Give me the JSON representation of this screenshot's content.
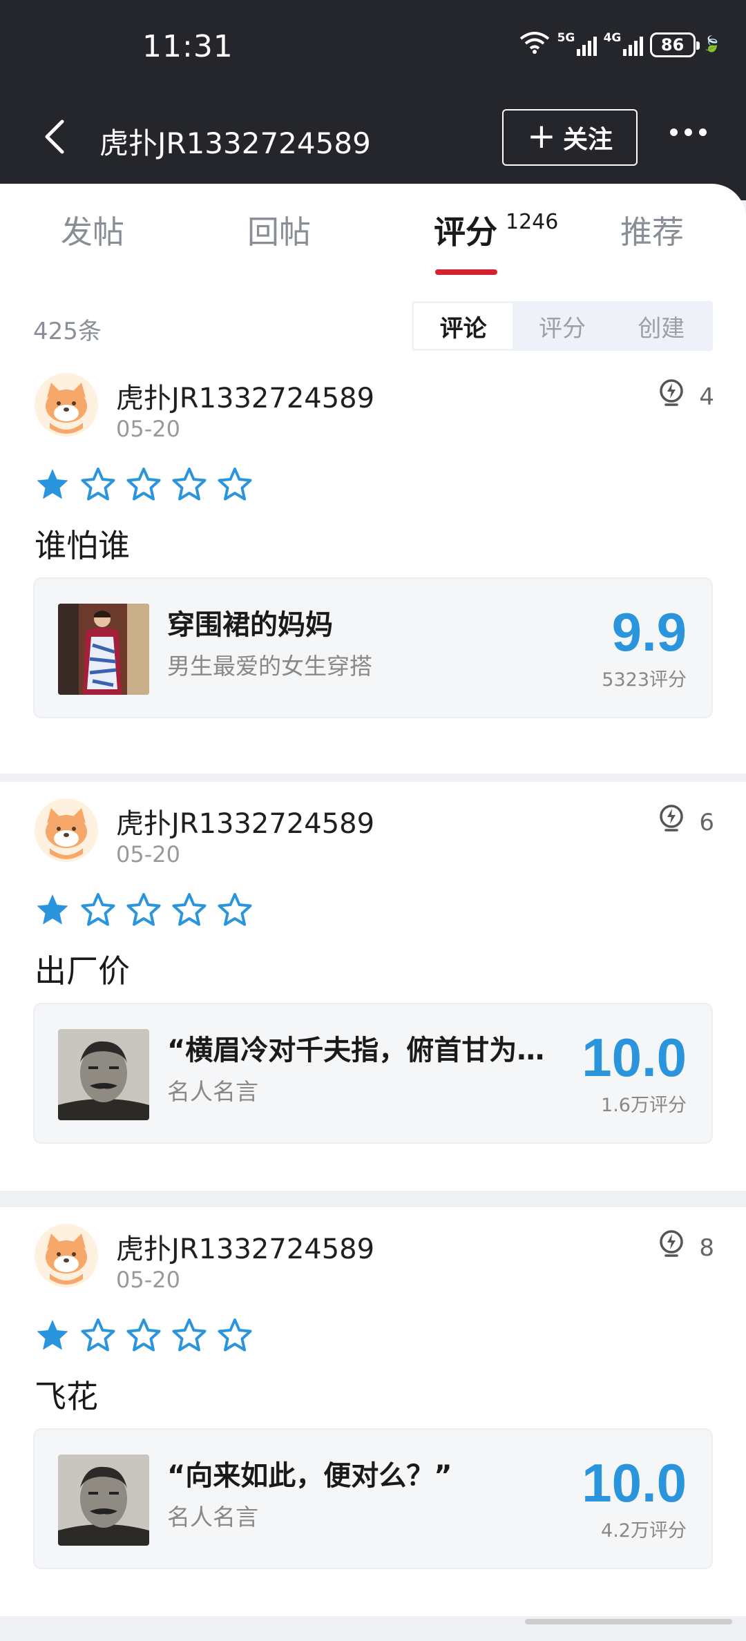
{
  "status_bar": {
    "time": "11:31",
    "sig1": "5G",
    "sig2": "4G",
    "battery": "86"
  },
  "nav": {
    "title": "虎扑JR1332724589",
    "follow_label": "关注"
  },
  "tabs": [
    {
      "label": "发帖"
    },
    {
      "label": "回帖"
    },
    {
      "label": "评分",
      "count": "1246"
    },
    {
      "label": "推荐"
    }
  ],
  "list_count": "425条",
  "segments": [
    "评论",
    "评分",
    "创建"
  ],
  "colors": {
    "accent": "#d42231",
    "star": "#2a94dd",
    "score": "#2a94dd"
  },
  "reviews": [
    {
      "user": "虎扑JR1332724589",
      "date": "05-20",
      "likes": "4",
      "rating_stars": 1,
      "text": "谁怕谁",
      "ref": {
        "title": "穿围裙的妈妈",
        "subtitle": "男生最爱的女生穿搭",
        "score": "9.9",
        "count": "5323评分"
      }
    },
    {
      "user": "虎扑JR1332724589",
      "date": "05-20",
      "likes": "6",
      "rating_stars": 1,
      "text": "出厂价",
      "ref": {
        "title": "“横眉冷对千夫指，俯首甘为孺子牛”",
        "subtitle": "名人名言",
        "score": "10.0",
        "count": "1.6万评分"
      }
    },
    {
      "user": "虎扑JR1332724589",
      "date": "05-20",
      "likes": "8",
      "rating_stars": 1,
      "text": "飞花",
      "ref": {
        "title": "“向来如此，便对么？”",
        "subtitle": "名人名言",
        "score": "10.0",
        "count": "4.2万评分"
      }
    }
  ]
}
